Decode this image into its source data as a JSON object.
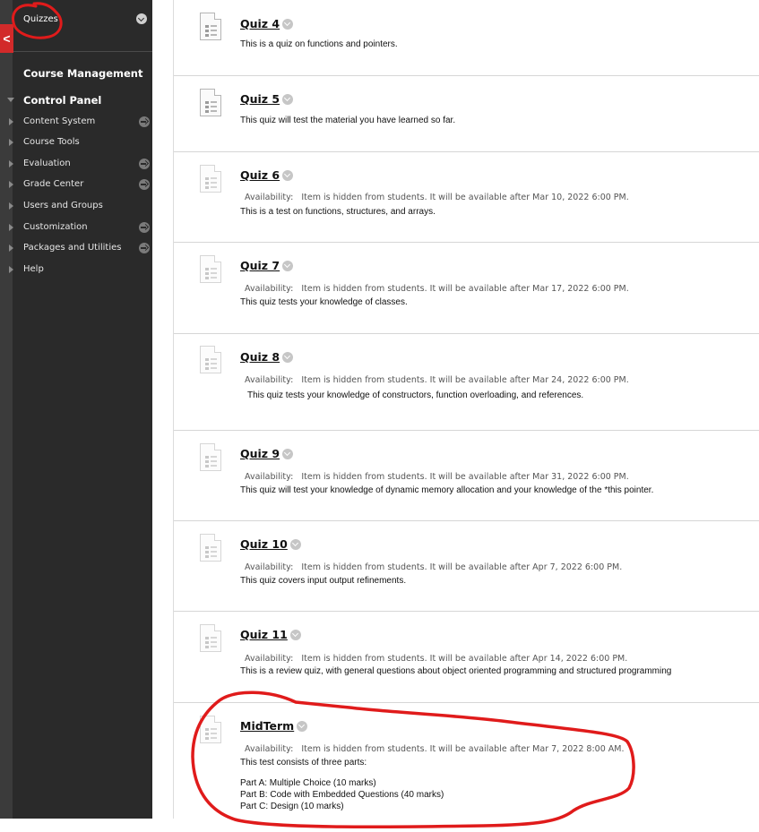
{
  "sidebar": {
    "collapse_glyph": "<",
    "quizzes_label": "Quizzes",
    "course_management": "Course Management",
    "control_panel": "Control Panel",
    "items": [
      {
        "label": "Content System",
        "has_go": true
      },
      {
        "label": "Course Tools",
        "has_go": false
      },
      {
        "label": "Evaluation",
        "has_go": true
      },
      {
        "label": "Grade Center",
        "has_go": true
      },
      {
        "label": "Users and Groups",
        "has_go": false
      },
      {
        "label": "Customization",
        "has_go": true
      },
      {
        "label": "Packages and Utilities",
        "has_go": true
      },
      {
        "label": "Help",
        "has_go": false
      }
    ]
  },
  "availability_label": "Availability:",
  "hidden_prefix": "Item is hidden from students.",
  "items": [
    {
      "title": "Quiz 4",
      "availability": "",
      "description": "This is a quiz on functions and pointers."
    },
    {
      "title": "Quiz 5",
      "availability": "",
      "description": "This quiz will test the material you have learned so far."
    },
    {
      "title": "Quiz 6",
      "availability": "It will be available after Mar 10, 2022 6:00 PM.",
      "description": "This is a test on functions, structures, and arrays."
    },
    {
      "title": "Quiz 7",
      "availability": "It will be available after Mar 17, 2022 6:00 PM.",
      "description": "This quiz tests your knowledge of classes."
    },
    {
      "title": "Quiz 8",
      "availability": "It will be available after Mar 24, 2022 6:00 PM.",
      "description": "This quiz tests your knowledge of constructors, function overloading, and references."
    },
    {
      "title": "Quiz 9",
      "availability": "It will be available after Mar 31, 2022 6:00 PM.",
      "description": "This quiz will test your knowledge of dynamic memory allocation and your knowledge of the *this pointer."
    },
    {
      "title": "Quiz 10",
      "availability": "It will be available after Apr 7, 2022 6:00 PM.",
      "description": "This quiz covers input output refinements."
    },
    {
      "title": "Quiz 11",
      "availability": "It will be available after Apr 14, 2022 6:00 PM.",
      "description": "This is a review quiz, with general questions about object oriented programming and structured programming"
    },
    {
      "title": "MidTerm",
      "availability": "It will be available after Mar 7, 2022 8:00 AM.",
      "description": "This test consists of three parts:",
      "parts": [
        "Part A: Multiple Choice (10 marks)",
        "Part B: Code with Embedded Questions (40 marks)",
        "Part C: Design (10 marks)"
      ]
    }
  ],
  "colors": {
    "sidebar_bg": "#2a2a2a",
    "accent_red": "#d22a2a",
    "annotation_red": "#e01b1b"
  }
}
